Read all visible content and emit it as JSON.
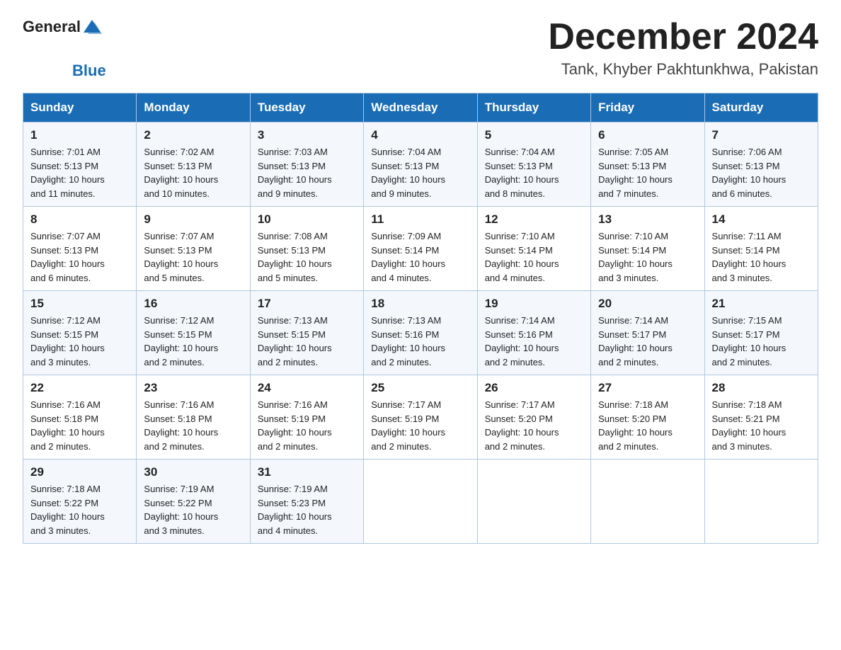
{
  "logo": {
    "text_general": "General",
    "text_blue": "Blue",
    "icon_alt": "GeneralBlue logo"
  },
  "header": {
    "month_year": "December 2024",
    "location": "Tank, Khyber Pakhtunkhwa, Pakistan"
  },
  "weekdays": [
    "Sunday",
    "Monday",
    "Tuesday",
    "Wednesday",
    "Thursday",
    "Friday",
    "Saturday"
  ],
  "weeks": [
    [
      {
        "day": "1",
        "sunrise": "7:01 AM",
        "sunset": "5:13 PM",
        "daylight": "10 hours and 11 minutes."
      },
      {
        "day": "2",
        "sunrise": "7:02 AM",
        "sunset": "5:13 PM",
        "daylight": "10 hours and 10 minutes."
      },
      {
        "day": "3",
        "sunrise": "7:03 AM",
        "sunset": "5:13 PM",
        "daylight": "10 hours and 9 minutes."
      },
      {
        "day": "4",
        "sunrise": "7:04 AM",
        "sunset": "5:13 PM",
        "daylight": "10 hours and 9 minutes."
      },
      {
        "day": "5",
        "sunrise": "7:04 AM",
        "sunset": "5:13 PM",
        "daylight": "10 hours and 8 minutes."
      },
      {
        "day": "6",
        "sunrise": "7:05 AM",
        "sunset": "5:13 PM",
        "daylight": "10 hours and 7 minutes."
      },
      {
        "day": "7",
        "sunrise": "7:06 AM",
        "sunset": "5:13 PM",
        "daylight": "10 hours and 6 minutes."
      }
    ],
    [
      {
        "day": "8",
        "sunrise": "7:07 AM",
        "sunset": "5:13 PM",
        "daylight": "10 hours and 6 minutes."
      },
      {
        "day": "9",
        "sunrise": "7:07 AM",
        "sunset": "5:13 PM",
        "daylight": "10 hours and 5 minutes."
      },
      {
        "day": "10",
        "sunrise": "7:08 AM",
        "sunset": "5:13 PM",
        "daylight": "10 hours and 5 minutes."
      },
      {
        "day": "11",
        "sunrise": "7:09 AM",
        "sunset": "5:14 PM",
        "daylight": "10 hours and 4 minutes."
      },
      {
        "day": "12",
        "sunrise": "7:10 AM",
        "sunset": "5:14 PM",
        "daylight": "10 hours and 4 minutes."
      },
      {
        "day": "13",
        "sunrise": "7:10 AM",
        "sunset": "5:14 PM",
        "daylight": "10 hours and 3 minutes."
      },
      {
        "day": "14",
        "sunrise": "7:11 AM",
        "sunset": "5:14 PM",
        "daylight": "10 hours and 3 minutes."
      }
    ],
    [
      {
        "day": "15",
        "sunrise": "7:12 AM",
        "sunset": "5:15 PM",
        "daylight": "10 hours and 3 minutes."
      },
      {
        "day": "16",
        "sunrise": "7:12 AM",
        "sunset": "5:15 PM",
        "daylight": "10 hours and 2 minutes."
      },
      {
        "day": "17",
        "sunrise": "7:13 AM",
        "sunset": "5:15 PM",
        "daylight": "10 hours and 2 minutes."
      },
      {
        "day": "18",
        "sunrise": "7:13 AM",
        "sunset": "5:16 PM",
        "daylight": "10 hours and 2 minutes."
      },
      {
        "day": "19",
        "sunrise": "7:14 AM",
        "sunset": "5:16 PM",
        "daylight": "10 hours and 2 minutes."
      },
      {
        "day": "20",
        "sunrise": "7:14 AM",
        "sunset": "5:17 PM",
        "daylight": "10 hours and 2 minutes."
      },
      {
        "day": "21",
        "sunrise": "7:15 AM",
        "sunset": "5:17 PM",
        "daylight": "10 hours and 2 minutes."
      }
    ],
    [
      {
        "day": "22",
        "sunrise": "7:16 AM",
        "sunset": "5:18 PM",
        "daylight": "10 hours and 2 minutes."
      },
      {
        "day": "23",
        "sunrise": "7:16 AM",
        "sunset": "5:18 PM",
        "daylight": "10 hours and 2 minutes."
      },
      {
        "day": "24",
        "sunrise": "7:16 AM",
        "sunset": "5:19 PM",
        "daylight": "10 hours and 2 minutes."
      },
      {
        "day": "25",
        "sunrise": "7:17 AM",
        "sunset": "5:19 PM",
        "daylight": "10 hours and 2 minutes."
      },
      {
        "day": "26",
        "sunrise": "7:17 AM",
        "sunset": "5:20 PM",
        "daylight": "10 hours and 2 minutes."
      },
      {
        "day": "27",
        "sunrise": "7:18 AM",
        "sunset": "5:20 PM",
        "daylight": "10 hours and 2 minutes."
      },
      {
        "day": "28",
        "sunrise": "7:18 AM",
        "sunset": "5:21 PM",
        "daylight": "10 hours and 3 minutes."
      }
    ],
    [
      {
        "day": "29",
        "sunrise": "7:18 AM",
        "sunset": "5:22 PM",
        "daylight": "10 hours and 3 minutes."
      },
      {
        "day": "30",
        "sunrise": "7:19 AM",
        "sunset": "5:22 PM",
        "daylight": "10 hours and 3 minutes."
      },
      {
        "day": "31",
        "sunrise": "7:19 AM",
        "sunset": "5:23 PM",
        "daylight": "10 hours and 4 minutes."
      },
      null,
      null,
      null,
      null
    ]
  ],
  "labels": {
    "sunrise": "Sunrise:",
    "sunset": "Sunset:",
    "daylight": "Daylight:"
  }
}
